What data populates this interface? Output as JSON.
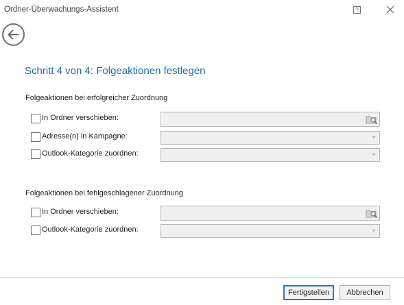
{
  "window": {
    "title": "Ordner-Überwachungs-Assistent",
    "help_label": "?"
  },
  "header": {
    "step_title": "Schritt 4 von 4: Folgeaktionen festlegen"
  },
  "success_section": {
    "title": "Folgeaktionen bei erfolgreicher Zuordnung",
    "rows": [
      {
        "label": "In Ordner verschieben:",
        "checked": false,
        "field": "browse",
        "value": ""
      },
      {
        "label": "Adresse(n) in Kampagne:",
        "checked": false,
        "field": "combo",
        "value": ""
      },
      {
        "label": "Outlook-Kategorie zuordnen:",
        "checked": false,
        "field": "combo",
        "value": ""
      }
    ]
  },
  "failure_section": {
    "title": "Folgeaktionen bei fehlgeschlagener Zuordnung",
    "rows": [
      {
        "label": "In Ordner verschieben:",
        "checked": false,
        "field": "browse",
        "value": ""
      },
      {
        "label": "Outlook-Kategorie zuordnen:",
        "checked": false,
        "field": "combo",
        "value": ""
      }
    ]
  },
  "footer": {
    "finish_label": "Fertigstellen",
    "cancel_label": "Abbrechen"
  },
  "icons": {
    "back": "back-arrow-icon",
    "close": "close-icon",
    "help": "help-icon",
    "browse": "folder-search-icon",
    "dropdown": "chevron-down-icon"
  },
  "colors": {
    "accent": "#1b6bb3",
    "primary_button_border": "#2b79c2",
    "disabled_field_bg": "#f0f0f0"
  }
}
